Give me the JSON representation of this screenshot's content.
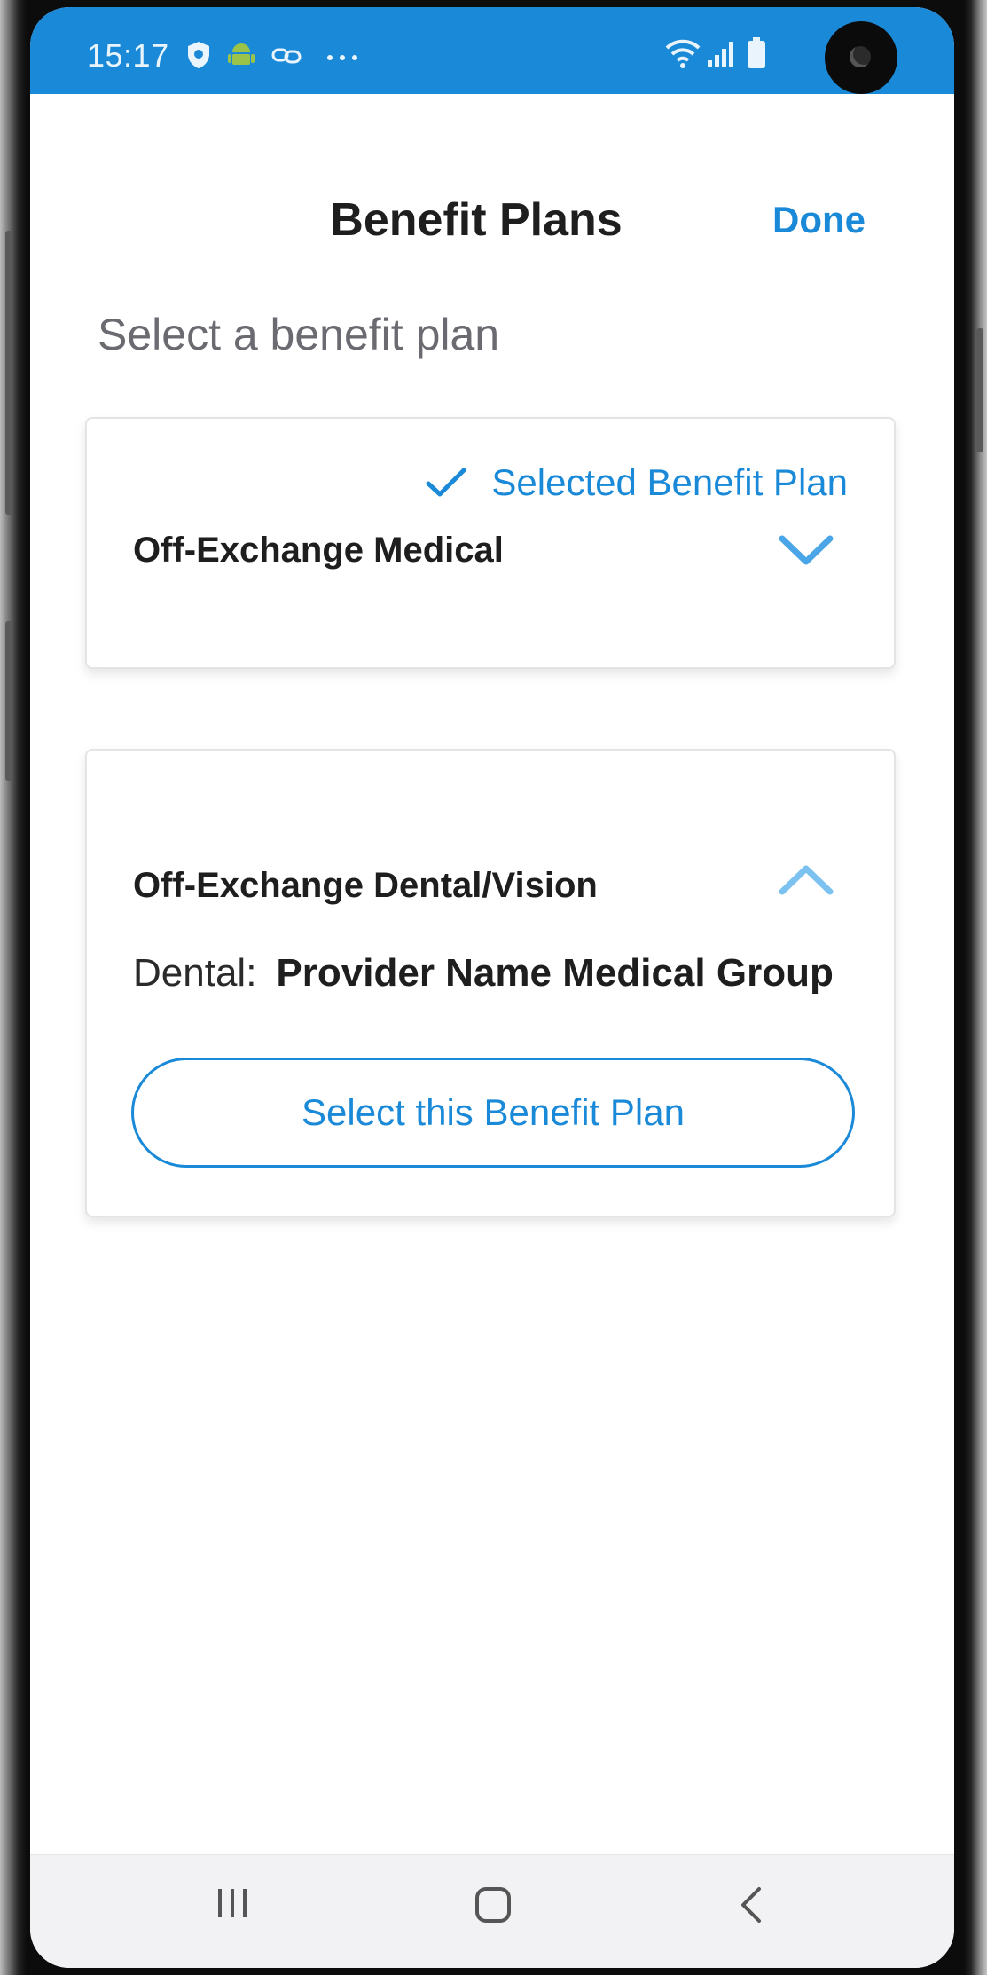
{
  "status_bar": {
    "time": "15:17",
    "left_icons": [
      "shield-icon",
      "android-icon",
      "link-icon",
      "more-dots-icon"
    ],
    "right_icons": [
      "wifi-icon",
      "signal-icon",
      "battery-icon"
    ],
    "color": "#1a8ad8"
  },
  "header": {
    "title": "Benefit Plans",
    "done_label": "Done"
  },
  "section_heading": "Select a benefit plan",
  "plans": [
    {
      "name": "Off-Exchange Medical",
      "selected": true,
      "selected_label": "Selected Benefit Plan",
      "expanded": false
    },
    {
      "name": "Off-Exchange Dental/Vision",
      "selected": false,
      "expanded": true,
      "provider_label": "Dental:",
      "provider_name": "Provider Name Medical Group",
      "select_button_label": "Select this Benefit Plan"
    }
  ],
  "nav_bar": {
    "buttons": [
      "recents-icon",
      "home-icon",
      "back-icon"
    ]
  },
  "colors": {
    "accent": "#1a8ad8",
    "text": "#1e1e1e",
    "muted": "#6a6a70"
  }
}
